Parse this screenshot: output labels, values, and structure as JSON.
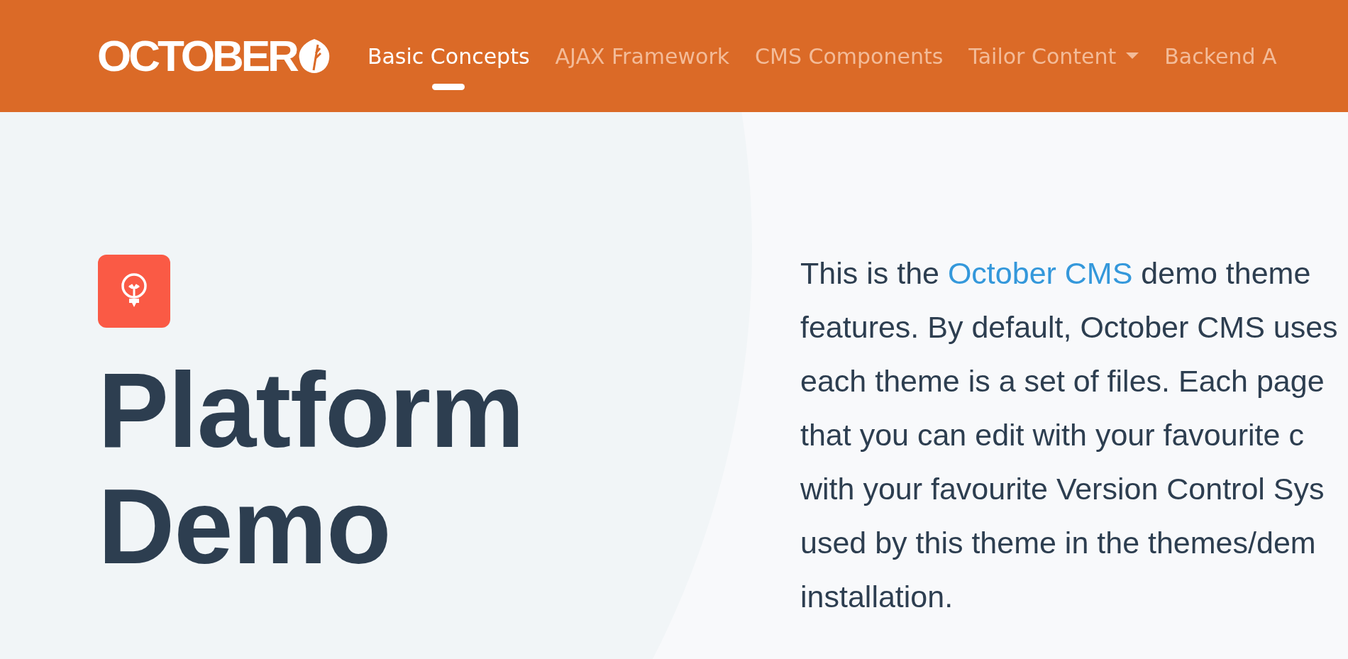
{
  "logo": {
    "text": "OCTOBER"
  },
  "nav": [
    {
      "label": "Basic Concepts",
      "selected": true,
      "dropdown": false
    },
    {
      "label": "AJAX Framework",
      "selected": false,
      "dropdown": false
    },
    {
      "label": "CMS Components",
      "selected": false,
      "dropdown": false
    },
    {
      "label": "Tailor Content",
      "selected": false,
      "dropdown": true
    },
    {
      "label": "Backend A",
      "selected": false,
      "dropdown": false
    }
  ],
  "hero": {
    "title_lines": [
      "Platform",
      "Demo"
    ],
    "intro_lines": [
      [
        {
          "kind": "text",
          "text": "This is the "
        },
        {
          "kind": "link",
          "text": "October CMS"
        },
        {
          "kind": "text",
          "text": " demo theme"
        }
      ],
      [
        {
          "kind": "text",
          "text": "features. By default, October CMS uses"
        }
      ],
      [
        {
          "kind": "text",
          "text": "each theme is a set of files. Each page"
        }
      ],
      [
        {
          "kind": "text",
          "text": "that you can edit with your favourite c"
        }
      ],
      [
        {
          "kind": "text",
          "text": "with your favourite Version Control Sys"
        }
      ],
      [
        {
          "kind": "text",
          "text": "used by this theme in the themes/dem"
        }
      ],
      [
        {
          "kind": "text",
          "text": "installation."
        }
      ]
    ]
  }
}
